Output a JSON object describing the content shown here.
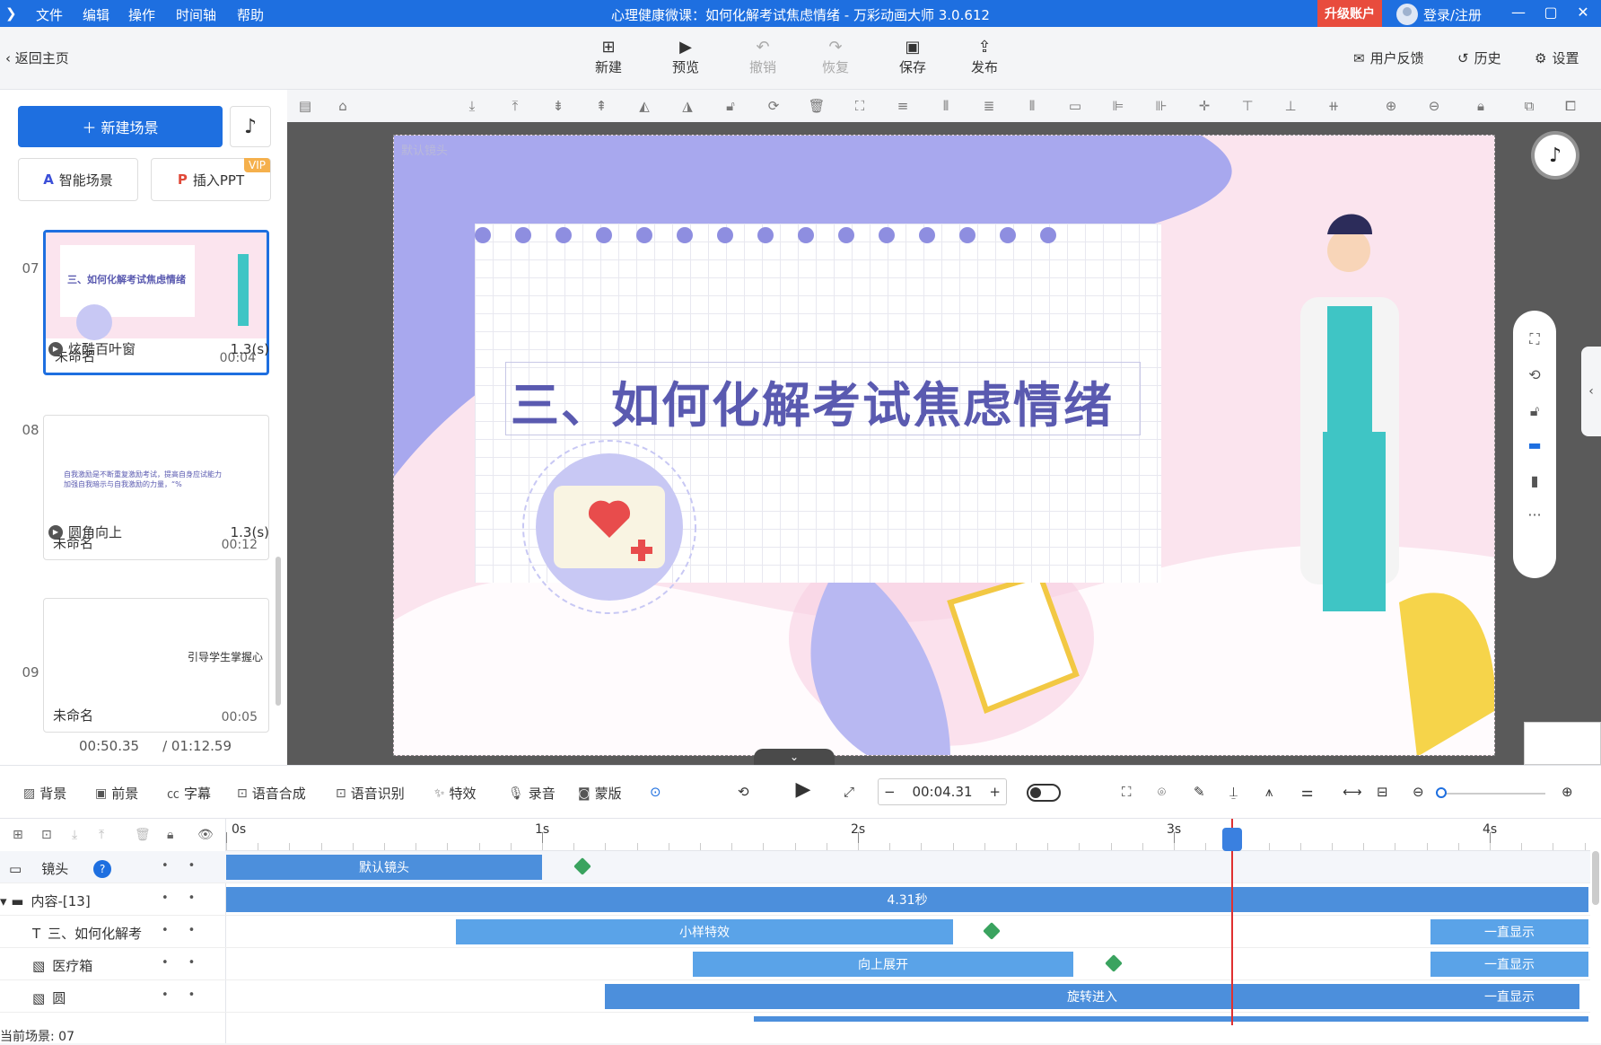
{
  "menu": [
    "文件",
    "编辑",
    "操作",
    "时间轴",
    "帮助"
  ],
  "window_title": "心理健康微课：如何化解考试焦虑情绪 - 万彩动画大师 3.0.612",
  "upgrade_label": "升级账户",
  "login_label": "登录/注册",
  "back_label": "返回主页",
  "toolbar": {
    "new": "新建",
    "preview": "预览",
    "undo": "撤销",
    "redo": "恢复",
    "save": "保存",
    "publish": "发布",
    "feedback": "用户反馈",
    "history": "历史",
    "settings": "设置"
  },
  "left": {
    "new_scene": "新建场景",
    "smart_scene": "智能场景",
    "insert_ppt": "插入PPT",
    "vip": "VIP",
    "scenes": [
      {
        "num": "07",
        "name": "未命名",
        "time": "00:04",
        "thumb_title": "三、如何化解考试焦虑情绪"
      },
      {
        "num": "08",
        "name": "未命名",
        "time": "00:12",
        "thumb_title": "自我激励是不断重复激励考试，提高自身应试能力\n加强自我暗示与自我激励的力量，“%"
      },
      {
        "num": "09",
        "name": "未命名",
        "time": "00:05",
        "thumb_title": "引导学生掌握心"
      }
    ],
    "transitions": [
      {
        "name": "炫酷百叶窗",
        "dur": "1.3(s)"
      },
      {
        "name": "圆角向上",
        "dur": "1.3(s)"
      }
    ],
    "current_time": "00:50.35",
    "total_time": "/ 01:12.59"
  },
  "canvas": {
    "camera_label": "默认镜头",
    "slide_title": "三、如何化解考试焦虑情绪",
    "colors": {
      "purple": "#a8a8ee",
      "pink": "#fbe4ee",
      "title": "#5a5ab0"
    }
  },
  "tl_toolbar": {
    "background": "背景",
    "foreground": "前景",
    "subtitle": "字幕",
    "tts": "语音合成",
    "asr": "语音识别",
    "effects": "特效",
    "record": "录音",
    "mask": "蒙版",
    "time": "00:04.31"
  },
  "timeline": {
    "ruler": [
      "0s",
      "1s",
      "2s",
      "3s",
      "4s"
    ],
    "rows": [
      {
        "label": "镜头",
        "bar": "默认镜头"
      },
      {
        "label": "内容-[13]",
        "bar": "4.31秒"
      },
      {
        "label": "三、如何化解考",
        "bar": "小样特效",
        "end": "一直显示"
      },
      {
        "label": "医疗箱",
        "bar": "向上展开",
        "end": "一直显示"
      },
      {
        "label": "圆",
        "bar": "旋转进入",
        "end": "一直显示"
      }
    ],
    "current_scene": "当前场景: 07"
  }
}
